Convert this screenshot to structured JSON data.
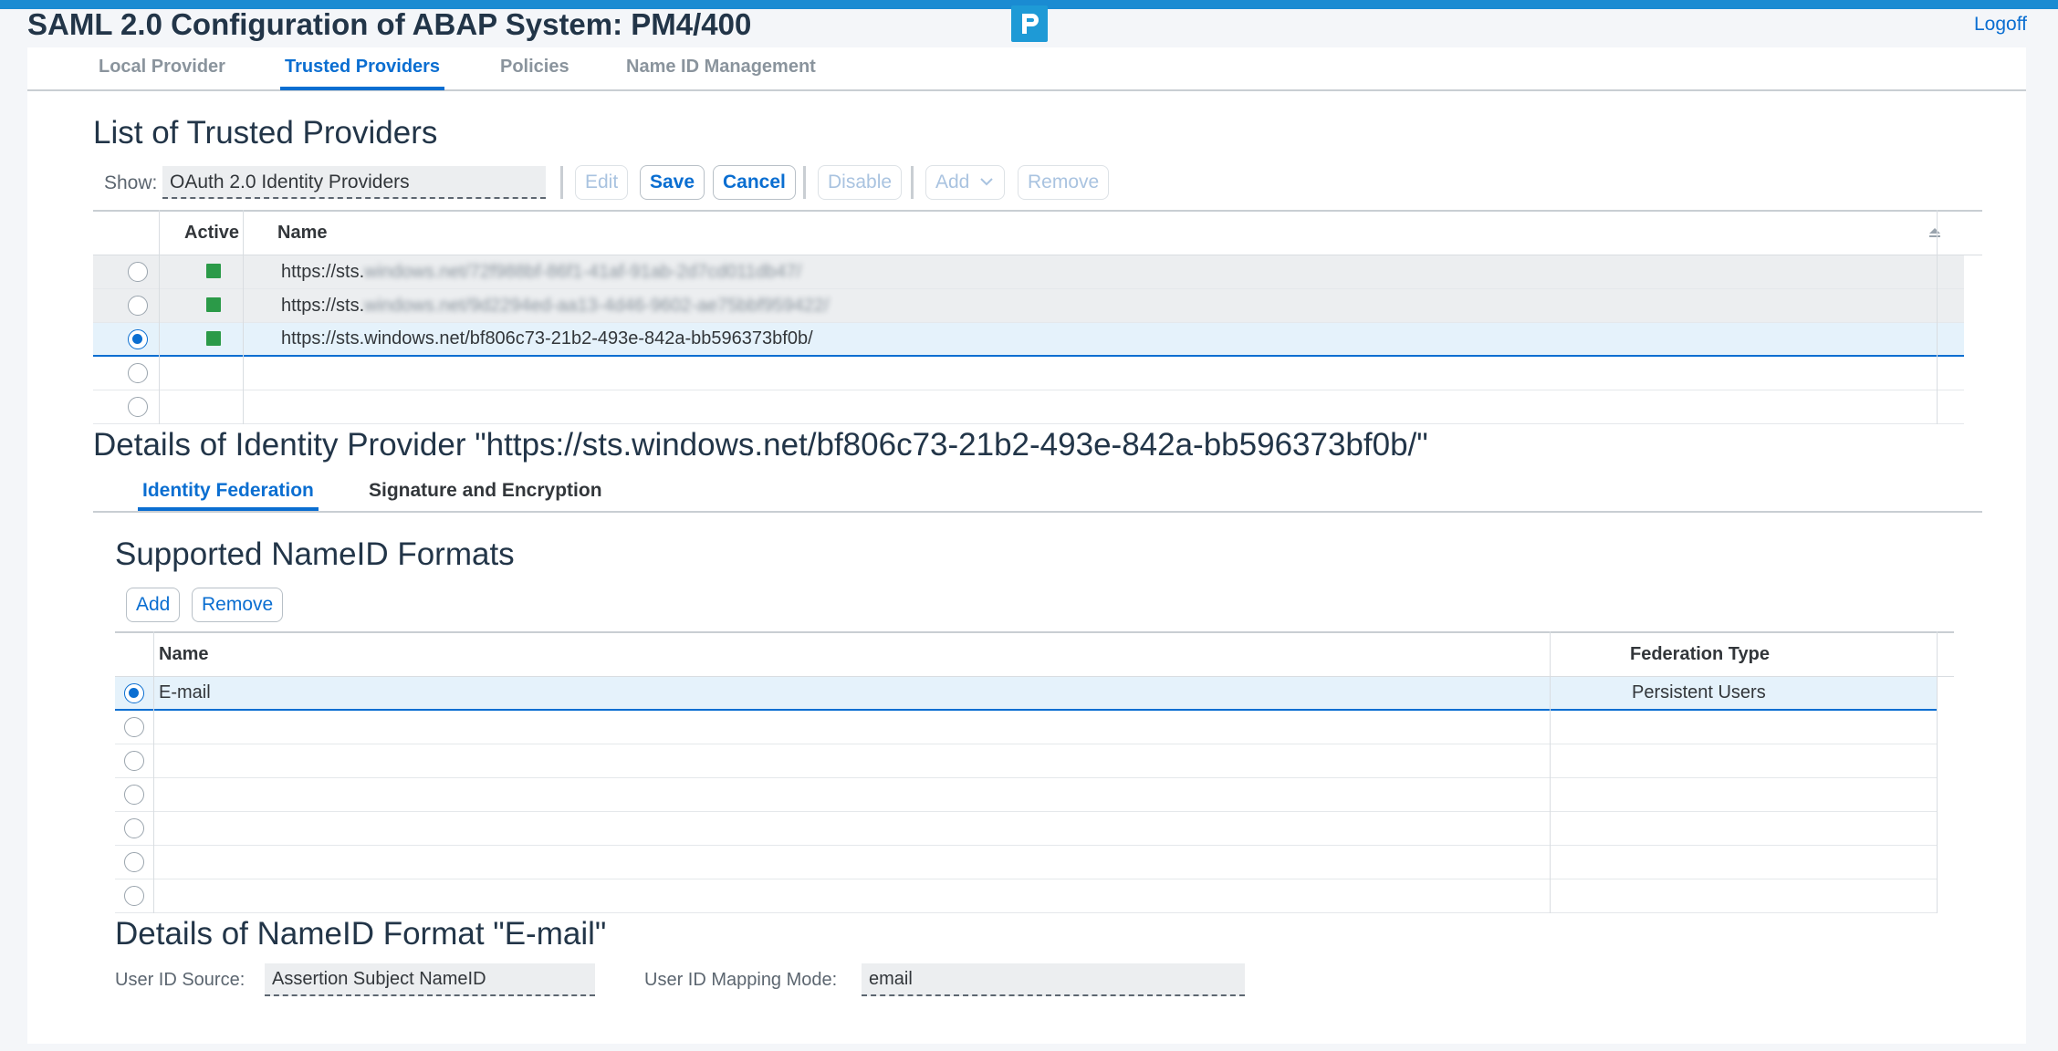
{
  "header": {
    "title": "SAML 2.0 Configuration of ABAP System: PM4/400",
    "logoff": "Logoff"
  },
  "main_tabs": [
    {
      "label": "Local Provider",
      "active": false
    },
    {
      "label": "Trusted Providers",
      "active": true
    },
    {
      "label": "Policies",
      "active": false
    },
    {
      "label": "Name ID Management",
      "active": false
    }
  ],
  "trusted": {
    "title": "List of Trusted Providers",
    "show_label": "Show:",
    "show_value": "OAuth 2.0 Identity Providers",
    "toolbar": {
      "edit": "Edit",
      "save": "Save",
      "cancel": "Cancel",
      "disable": "Disable",
      "add": "Add",
      "remove": "Remove"
    },
    "columns": {
      "active": "Active",
      "name": "Name"
    },
    "rows": [
      {
        "name_visible": "https://sts.",
        "name_blurred": "windows.net/72f988bf-86f1-41af-91ab-2d7cd011db47/",
        "active": true,
        "selected": false
      },
      {
        "name_visible": "https://sts.",
        "name_blurred": "windows.net/9d2294ed-aa13-4d46-9602-ae75bbf959422/",
        "active": true,
        "selected": false
      },
      {
        "name_visible": "https://sts.windows.net/bf806c73-21b2-493e-842a-bb596373bf0b/",
        "name_blurred": "",
        "active": true,
        "selected": true
      }
    ]
  },
  "details": {
    "title": "Details of Identity Provider \"https://sts.windows.net/bf806c73-21b2-493e-842a-bb596373bf0b/\"",
    "tabs": [
      {
        "label": "Identity Federation",
        "active": true
      },
      {
        "label": "Signature and Encryption",
        "active": false
      }
    ]
  },
  "nameid": {
    "title": "Supported NameID Formats",
    "add": "Add",
    "remove": "Remove",
    "columns": {
      "name": "Name",
      "federation_type": "Federation Type"
    },
    "rows": [
      {
        "name": "E-mail",
        "federation_type": "Persistent Users",
        "selected": true
      }
    ]
  },
  "nameid_details": {
    "title": "Details of NameID Format \"E-mail\"",
    "user_id_source_label": "User ID Source:",
    "user_id_source_value": "Assertion Subject NameID",
    "user_id_mapping_label": "User ID Mapping Mode:",
    "user_id_mapping_value": "email"
  },
  "colors": {
    "accent": "#0a6ed1",
    "active_indicator": "#2b9a48",
    "top_bar": "#1a8bd2"
  }
}
